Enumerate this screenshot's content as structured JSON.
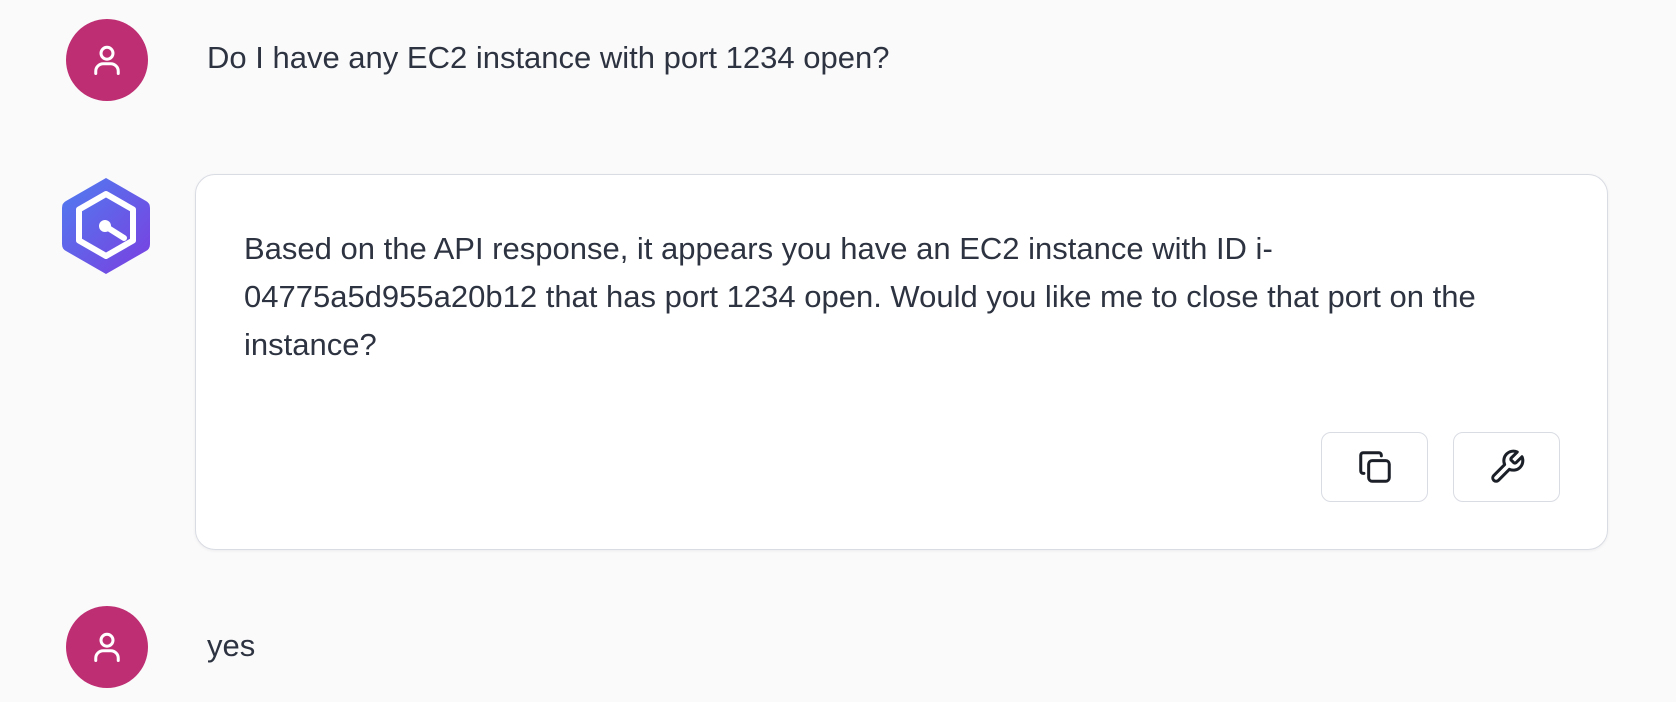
{
  "messages": [
    {
      "role": "user",
      "avatar_icon": "user-icon",
      "text": "Do I have any EC2 instance with port 1234 open?"
    },
    {
      "role": "assistant",
      "avatar_icon": "hexagon-logo-icon",
      "text": "Based on the API response, it appears you have an EC2 instance with ID i-04775a5d955a20b12 that has port 1234 open. Would you like me to close that port on the instance?",
      "actions": [
        {
          "icon": "copy-icon"
        },
        {
          "icon": "wrench-icon"
        }
      ]
    },
    {
      "role": "user",
      "avatar_icon": "user-icon",
      "text": "yes"
    }
  ],
  "colors": {
    "background": "#fafafb",
    "user_avatar": "#be2e72",
    "bot_logo_gradient": [
      "#4f7df0",
      "#7b3ee0"
    ],
    "card_border": "#d9dce3",
    "text": "#2d3340"
  }
}
